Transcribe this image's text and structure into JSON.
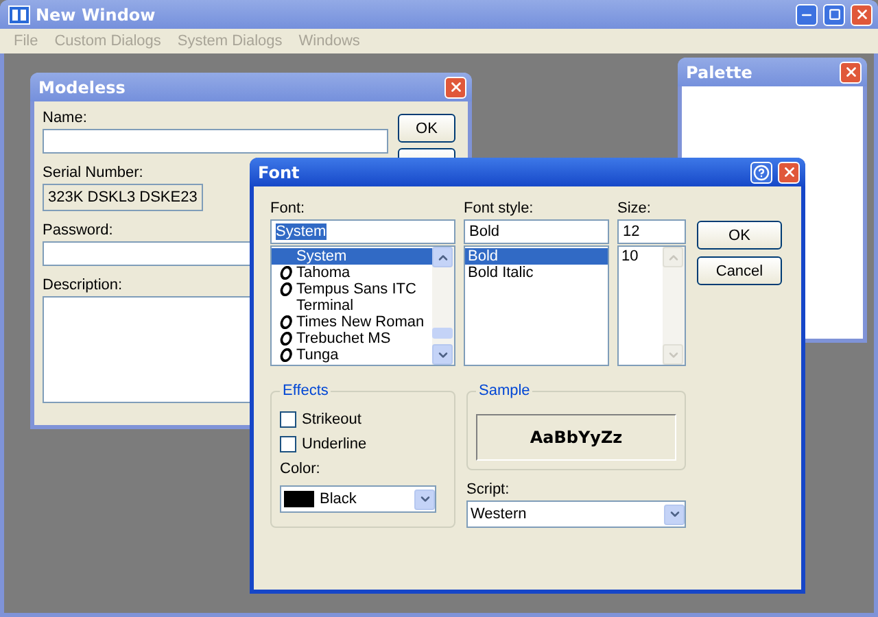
{
  "main_window": {
    "title": "New Window",
    "menu": [
      {
        "label": "File",
        "disabled": true
      },
      {
        "label": "Custom Dialogs",
        "disabled": true
      },
      {
        "label": "System Dialogs",
        "disabled": true
      },
      {
        "label": "Windows",
        "disabled": true
      }
    ]
  },
  "modeless": {
    "title": "Modeless",
    "fields": [
      {
        "kind": "input",
        "label": "Name:"
      },
      {
        "kind": "readonly",
        "label": "Serial Number:",
        "value": "323K DSKL3 DSKE23"
      },
      {
        "kind": "input",
        "label": "Password:"
      },
      {
        "kind": "textarea",
        "label": "Description:"
      }
    ],
    "buttons": [
      "OK"
    ]
  },
  "palette": {
    "title": "Palette"
  },
  "font_dialog": {
    "title": "Font",
    "font": {
      "label": "Font:",
      "value": "System",
      "items": [
        {
          "label": "System",
          "kind": "raster",
          "selected": true
        },
        {
          "label": "Tahoma",
          "kind": "opentype",
          "selected": false
        },
        {
          "label": "Tempus Sans ITC",
          "kind": "opentype",
          "selected": false
        },
        {
          "label": "Terminal",
          "kind": "raster",
          "selected": false
        },
        {
          "label": "Times New Roman",
          "kind": "opentype",
          "selected": false
        },
        {
          "label": "Trebuchet MS",
          "kind": "opentype",
          "selected": false
        },
        {
          "label": "Tunga",
          "kind": "opentype",
          "selected": false
        }
      ]
    },
    "style": {
      "label": "Font style:",
      "value": "Bold",
      "items": [
        {
          "label": "Bold",
          "selected": true
        },
        {
          "label": "Bold Italic",
          "selected": false
        }
      ]
    },
    "size": {
      "label": "Size:",
      "value": "12",
      "items": [
        {
          "label": "10",
          "selected": false
        }
      ]
    },
    "buttons": [
      "OK",
      "Cancel"
    ],
    "effects": {
      "title": "Effects",
      "options": [
        {
          "label": "Strikeout",
          "checked": false
        },
        {
          "label": "Underline",
          "checked": false
        }
      ],
      "color_label": "Color:",
      "color": {
        "label": "Black",
        "color": "#000000"
      }
    },
    "sample": {
      "title": "Sample",
      "text": "AaBbYyZz"
    },
    "script": {
      "label": "Script:",
      "value": "Western"
    }
  }
}
